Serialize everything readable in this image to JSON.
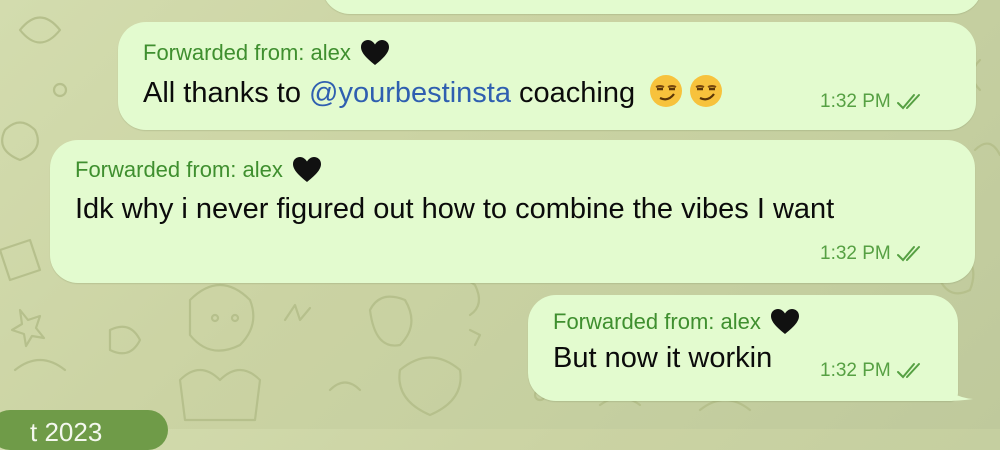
{
  "messages": [
    {
      "forwarded": "Forwarded from: alex",
      "text_before": "All thanks to ",
      "mention": "@yourbestinsta",
      "text_after": " coaching",
      "emoji": [
        "smirking-face",
        "smirking-face"
      ],
      "time": "1:32 PM",
      "status": "read"
    },
    {
      "forwarded": "Forwarded from: alex",
      "text": "Idk why i never figured out how to combine the vibes I want",
      "time": "1:32 PM",
      "status": "read"
    },
    {
      "forwarded": "Forwarded from: alex",
      "text": "But now it workin",
      "time": "1:32 PM",
      "status": "read"
    }
  ],
  "date_pill": "t 2023",
  "colors": {
    "bubble": "#e3fbcf",
    "forwarded_text": "#3f8f2f",
    "mention": "#2f5fb0",
    "time": "#56a043",
    "background": "#cbd3a3"
  }
}
